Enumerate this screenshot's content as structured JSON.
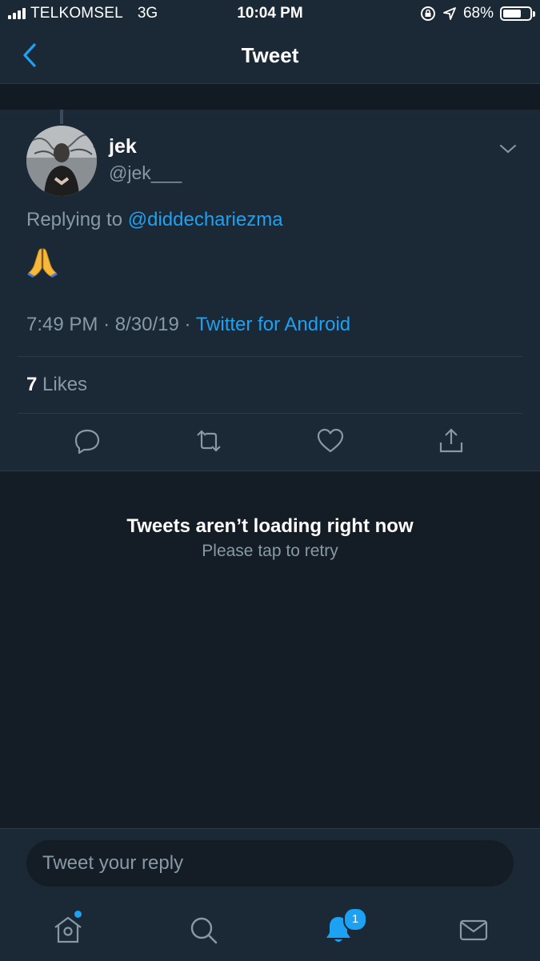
{
  "status_bar": {
    "carrier": "TELKOMSEL",
    "network": "3G",
    "time": "10:04 PM",
    "battery_percent": "68%",
    "battery_level": 0.68
  },
  "nav": {
    "title": "Tweet",
    "back_icon": "chevron-left-icon"
  },
  "tweet": {
    "display_name": "jek",
    "handle": "@jek___",
    "replying_prefix": "Replying to",
    "replying_to": "@diddechariezma",
    "body_emoji": "folded-hands",
    "time": "7:49 PM",
    "date": "8/30/19",
    "source": "Twitter for Android",
    "separator": "·",
    "likes_count": "7",
    "likes_label": "Likes"
  },
  "actions": [
    "reply-icon",
    "retweet-icon",
    "like-icon",
    "share-icon"
  ],
  "empty_state": {
    "title": "Tweets aren’t loading right now",
    "subtitle": "Please tap to retry"
  },
  "composer": {
    "placeholder": "Tweet your reply"
  },
  "tab_bar": {
    "items": [
      "home-icon",
      "search-icon",
      "notifications-icon",
      "messages-icon"
    ],
    "notifications_badge": "1"
  },
  "colors": {
    "accent": "#1da1f2",
    "background": "#141d26",
    "surface": "#1b2836",
    "secondary_text": "#8899a6"
  }
}
